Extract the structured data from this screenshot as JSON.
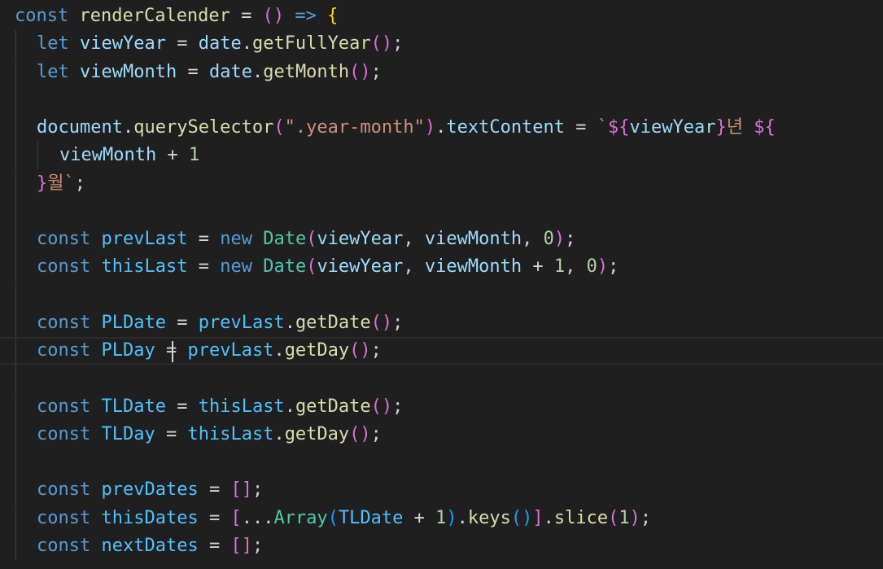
{
  "editor": {
    "lines": [
      [
        {
          "t": "const",
          "c": "kw"
        },
        {
          "t": " "
        },
        {
          "t": "renderCalender",
          "c": "fn"
        },
        {
          "t": " "
        },
        {
          "t": "=",
          "c": "op"
        },
        {
          "t": " "
        },
        {
          "t": "()",
          "c": "b2"
        },
        {
          "t": " "
        },
        {
          "t": "=>",
          "c": "kw"
        },
        {
          "t": " "
        },
        {
          "t": "{",
          "c": "b1"
        }
      ],
      [
        {
          "t": "let",
          "c": "kw"
        },
        {
          "t": " "
        },
        {
          "t": "viewYear",
          "c": "var"
        },
        {
          "t": " "
        },
        {
          "t": "=",
          "c": "op"
        },
        {
          "t": " "
        },
        {
          "t": "date",
          "c": "var"
        },
        {
          "t": "."
        },
        {
          "t": "getFullYear",
          "c": "fn"
        },
        {
          "t": "()",
          "c": "b2"
        },
        {
          "t": ";"
        }
      ],
      [
        {
          "t": "let",
          "c": "kw"
        },
        {
          "t": " "
        },
        {
          "t": "viewMonth",
          "c": "var"
        },
        {
          "t": " "
        },
        {
          "t": "=",
          "c": "op"
        },
        {
          "t": " "
        },
        {
          "t": "date",
          "c": "var"
        },
        {
          "t": "."
        },
        {
          "t": "getMonth",
          "c": "fn"
        },
        {
          "t": "()",
          "c": "b2"
        },
        {
          "t": ";"
        }
      ],
      [],
      [
        {
          "t": "document",
          "c": "var"
        },
        {
          "t": "."
        },
        {
          "t": "querySelector",
          "c": "fn"
        },
        {
          "t": "(",
          "c": "b2"
        },
        {
          "t": "\".year-month\"",
          "c": "str"
        },
        {
          "t": ")",
          "c": "b2"
        },
        {
          "t": "."
        },
        {
          "t": "textContent",
          "c": "var"
        },
        {
          "t": " "
        },
        {
          "t": "=",
          "c": "op"
        },
        {
          "t": " "
        },
        {
          "t": "`",
          "c": "str"
        },
        {
          "t": "${",
          "c": "b2"
        },
        {
          "t": "viewYear",
          "c": "var"
        },
        {
          "t": "}",
          "c": "b2"
        },
        {
          "t": "년 ",
          "c": "str"
        },
        {
          "t": "${",
          "c": "b2"
        }
      ],
      [
        {
          "t": "viewMonth",
          "c": "var"
        },
        {
          "t": " "
        },
        {
          "t": "+",
          "c": "op"
        },
        {
          "t": " "
        },
        {
          "t": "1",
          "c": "num"
        }
      ],
      [
        {
          "t": "}",
          "c": "b2"
        },
        {
          "t": "월`",
          "c": "str"
        },
        {
          "t": ";"
        }
      ],
      [],
      [
        {
          "t": "const",
          "c": "kw"
        },
        {
          "t": " "
        },
        {
          "t": "prevLast",
          "c": "const"
        },
        {
          "t": " "
        },
        {
          "t": "=",
          "c": "op"
        },
        {
          "t": " "
        },
        {
          "t": "new",
          "c": "kw"
        },
        {
          "t": " "
        },
        {
          "t": "Date",
          "c": "cls"
        },
        {
          "t": "(",
          "c": "b2"
        },
        {
          "t": "viewYear",
          "c": "var"
        },
        {
          "t": ", "
        },
        {
          "t": "viewMonth",
          "c": "var"
        },
        {
          "t": ", "
        },
        {
          "t": "0",
          "c": "num"
        },
        {
          "t": ")",
          "c": "b2"
        },
        {
          "t": ";"
        }
      ],
      [
        {
          "t": "const",
          "c": "kw"
        },
        {
          "t": " "
        },
        {
          "t": "thisLast",
          "c": "const"
        },
        {
          "t": " "
        },
        {
          "t": "=",
          "c": "op"
        },
        {
          "t": " "
        },
        {
          "t": "new",
          "c": "kw"
        },
        {
          "t": " "
        },
        {
          "t": "Date",
          "c": "cls"
        },
        {
          "t": "(",
          "c": "b2"
        },
        {
          "t": "viewYear",
          "c": "var"
        },
        {
          "t": ", "
        },
        {
          "t": "viewMonth",
          "c": "var"
        },
        {
          "t": " "
        },
        {
          "t": "+",
          "c": "op"
        },
        {
          "t": " "
        },
        {
          "t": "1",
          "c": "num"
        },
        {
          "t": ", "
        },
        {
          "t": "0",
          "c": "num"
        },
        {
          "t": ")",
          "c": "b2"
        },
        {
          "t": ";"
        }
      ],
      [],
      [
        {
          "t": "const",
          "c": "kw"
        },
        {
          "t": " "
        },
        {
          "t": "PLDate",
          "c": "const"
        },
        {
          "t": " "
        },
        {
          "t": "=",
          "c": "op"
        },
        {
          "t": " "
        },
        {
          "t": "prevLast",
          "c": "const"
        },
        {
          "t": "."
        },
        {
          "t": "getDate",
          "c": "fn"
        },
        {
          "t": "()",
          "c": "b2"
        },
        {
          "t": ";"
        }
      ],
      [
        {
          "t": "const",
          "c": "kw"
        },
        {
          "t": " "
        },
        {
          "t": "PLDay",
          "c": "const"
        },
        {
          "t": " "
        },
        {
          "t": "=",
          "c": "op"
        },
        {
          "t": " "
        },
        {
          "t": "prevLast",
          "c": "const"
        },
        {
          "t": "."
        },
        {
          "t": "getDay",
          "c": "fn"
        },
        {
          "t": "()",
          "c": "b2"
        },
        {
          "t": ";"
        }
      ],
      [],
      [
        {
          "t": "const",
          "c": "kw"
        },
        {
          "t": " "
        },
        {
          "t": "TLDate",
          "c": "const"
        },
        {
          "t": " "
        },
        {
          "t": "=",
          "c": "op"
        },
        {
          "t": " "
        },
        {
          "t": "thisLast",
          "c": "const"
        },
        {
          "t": "."
        },
        {
          "t": "getDate",
          "c": "fn"
        },
        {
          "t": "()",
          "c": "b2"
        },
        {
          "t": ";"
        }
      ],
      [
        {
          "t": "const",
          "c": "kw"
        },
        {
          "t": " "
        },
        {
          "t": "TLDay",
          "c": "const"
        },
        {
          "t": " "
        },
        {
          "t": "=",
          "c": "op"
        },
        {
          "t": " "
        },
        {
          "t": "thisLast",
          "c": "const"
        },
        {
          "t": "."
        },
        {
          "t": "getDay",
          "c": "fn"
        },
        {
          "t": "()",
          "c": "b2"
        },
        {
          "t": ";"
        }
      ],
      [],
      [
        {
          "t": "const",
          "c": "kw"
        },
        {
          "t": " "
        },
        {
          "t": "prevDates",
          "c": "const"
        },
        {
          "t": " "
        },
        {
          "t": "=",
          "c": "op"
        },
        {
          "t": " "
        },
        {
          "t": "[]",
          "c": "b2"
        },
        {
          "t": ";"
        }
      ],
      [
        {
          "t": "const",
          "c": "kw"
        },
        {
          "t": " "
        },
        {
          "t": "thisDates",
          "c": "const"
        },
        {
          "t": " "
        },
        {
          "t": "=",
          "c": "op"
        },
        {
          "t": " "
        },
        {
          "t": "[",
          "c": "b2"
        },
        {
          "t": "..."
        },
        {
          "t": "Array",
          "c": "cls"
        },
        {
          "t": "(",
          "c": "b3"
        },
        {
          "t": "TLDate",
          "c": "const"
        },
        {
          "t": " "
        },
        {
          "t": "+",
          "c": "op"
        },
        {
          "t": " "
        },
        {
          "t": "1",
          "c": "num"
        },
        {
          "t": ")",
          "c": "b3"
        },
        {
          "t": "."
        },
        {
          "t": "keys",
          "c": "fn"
        },
        {
          "t": "()",
          "c": "b3"
        },
        {
          "t": "]",
          "c": "b2"
        },
        {
          "t": "."
        },
        {
          "t": "slice",
          "c": "fn"
        },
        {
          "t": "(",
          "c": "b2"
        },
        {
          "t": "1",
          "c": "num"
        },
        {
          "t": ")",
          "c": "b2"
        },
        {
          "t": ";"
        }
      ],
      [
        {
          "t": "const",
          "c": "kw"
        },
        {
          "t": " "
        },
        {
          "t": "nextDates",
          "c": "const"
        },
        {
          "t": " "
        },
        {
          "t": "=",
          "c": "op"
        },
        {
          "t": " "
        },
        {
          "t": "[]",
          "c": "b2"
        },
        {
          "t": ";"
        }
      ]
    ]
  }
}
